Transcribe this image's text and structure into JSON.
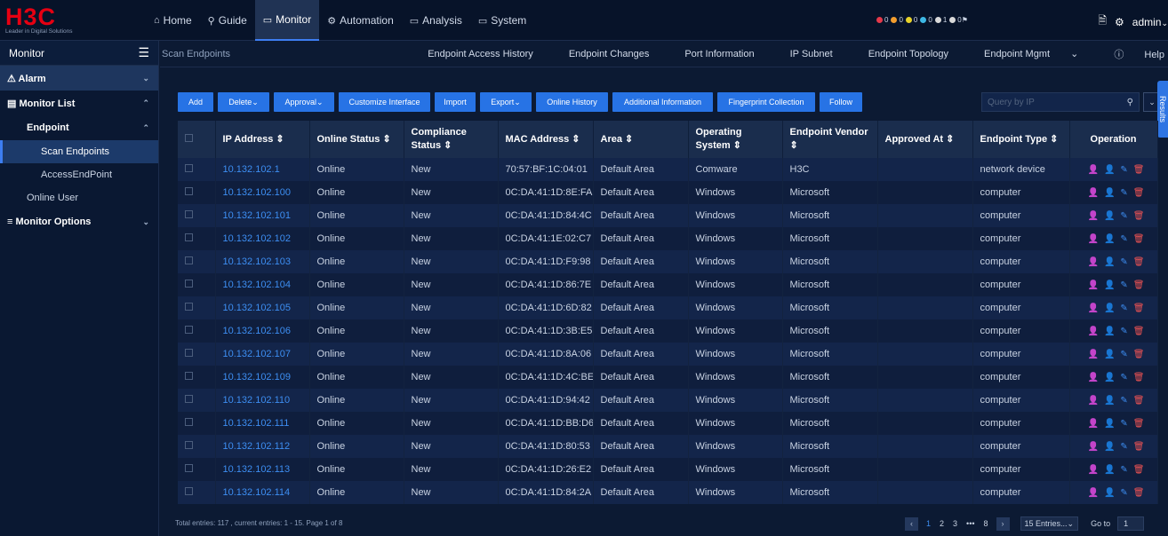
{
  "brand": {
    "name": "H3C",
    "tagline": "Leader in Digital Solutions"
  },
  "nav": [
    {
      "label": "Home",
      "icon": "home-icon",
      "glyph": "⌂",
      "active": false
    },
    {
      "label": "Guide",
      "icon": "guide-icon",
      "glyph": "⚲",
      "active": false
    },
    {
      "label": "Monitor",
      "icon": "monitor-icon",
      "glyph": "▭",
      "active": true
    },
    {
      "label": "Automation",
      "icon": "automation-icon",
      "glyph": "⚙",
      "active": false
    },
    {
      "label": "Analysis",
      "icon": "analysis-icon",
      "glyph": "▭",
      "active": false
    },
    {
      "label": "System",
      "icon": "system-icon",
      "glyph": "▭",
      "active": false
    }
  ],
  "status_counts": [
    {
      "color": "#e5394a",
      "count": "0"
    },
    {
      "color": "#f29d2e",
      "count": "0"
    },
    {
      "color": "#e8d32a",
      "count": "0"
    },
    {
      "color": "#3db8e5",
      "count": "0"
    },
    {
      "color": "#d9d9d9",
      "count": "1"
    },
    {
      "color": "#d9d9d9",
      "count": "0"
    }
  ],
  "user": {
    "name": "admin"
  },
  "sidebar": {
    "title": "Monitor",
    "alarm": "Alarm",
    "monitor_list": "Monitor List",
    "endpoint": "Endpoint",
    "scan_endpoints": "Scan Endpoints",
    "access_endpoint": "AccessEndPoint",
    "online_user": "Online User",
    "monitor_options": "Monitor Options"
  },
  "breadcrumb": "Scan Endpoints",
  "subtabs": [
    "Endpoint Access History",
    "Endpoint Changes",
    "Port Information",
    "IP Subnet",
    "Endpoint Topology",
    "Endpoint Mgmt"
  ],
  "help": "Help",
  "toolbar": [
    {
      "label": "Add",
      "dropdown": false,
      "w": 40
    },
    {
      "label": "Delete",
      "dropdown": true,
      "w": 58
    },
    {
      "label": "Approval",
      "dropdown": true,
      "w": 68
    },
    {
      "label": "Customize Interface",
      "dropdown": false,
      "w": 103
    },
    {
      "label": "Import",
      "dropdown": false,
      "w": 46
    },
    {
      "label": "Export",
      "dropdown": true,
      "w": 58
    },
    {
      "label": "Online History",
      "dropdown": false,
      "w": 81
    },
    {
      "label": "Additional Information",
      "dropdown": false,
      "w": 113
    },
    {
      "label": "Fingerprint Collection",
      "dropdown": false,
      "w": 110
    },
    {
      "label": "Follow",
      "dropdown": false,
      "w": 48
    }
  ],
  "search": {
    "placeholder": "Query by IP"
  },
  "results_tab": "Results",
  "table": {
    "columns": [
      "IP Address",
      "Online Status",
      "Compliance Status",
      "MAC Address",
      "Area",
      "Operating System",
      "Endpoint Vendor",
      "Approved At",
      "Endpoint Type",
      "Operation"
    ],
    "rows": [
      [
        "10.132.102.1",
        "Online",
        "New",
        "70:57:BF:1C:04:01",
        "Default Area",
        "Comware",
        "H3C",
        "",
        "network device"
      ],
      [
        "10.132.102.100",
        "Online",
        "New",
        "0C:DA:41:1D:8E:FA",
        "Default Area",
        "Windows",
        "Microsoft",
        "",
        "computer"
      ],
      [
        "10.132.102.101",
        "Online",
        "New",
        "0C:DA:41:1D:84:4C",
        "Default Area",
        "Windows",
        "Microsoft",
        "",
        "computer"
      ],
      [
        "10.132.102.102",
        "Online",
        "New",
        "0C:DA:41:1E:02:C7",
        "Default Area",
        "Windows",
        "Microsoft",
        "",
        "computer"
      ],
      [
        "10.132.102.103",
        "Online",
        "New",
        "0C:DA:41:1D:F9:98",
        "Default Area",
        "Windows",
        "Microsoft",
        "",
        "computer"
      ],
      [
        "10.132.102.104",
        "Online",
        "New",
        "0C:DA:41:1D:86:7E",
        "Default Area",
        "Windows",
        "Microsoft",
        "",
        "computer"
      ],
      [
        "10.132.102.105",
        "Online",
        "New",
        "0C:DA:41:1D:6D:82",
        "Default Area",
        "Windows",
        "Microsoft",
        "",
        "computer"
      ],
      [
        "10.132.102.106",
        "Online",
        "New",
        "0C:DA:41:1D:3B:E5",
        "Default Area",
        "Windows",
        "Microsoft",
        "",
        "computer"
      ],
      [
        "10.132.102.107",
        "Online",
        "New",
        "0C:DA:41:1D:8A:06",
        "Default Area",
        "Windows",
        "Microsoft",
        "",
        "computer"
      ],
      [
        "10.132.102.109",
        "Online",
        "New",
        "0C:DA:41:1D:4C:BE",
        "Default Area",
        "Windows",
        "Microsoft",
        "",
        "computer"
      ],
      [
        "10.132.102.110",
        "Online",
        "New",
        "0C:DA:41:1D:94:42",
        "Default Area",
        "Windows",
        "Microsoft",
        "",
        "computer"
      ],
      [
        "10.132.102.111",
        "Online",
        "New",
        "0C:DA:41:1D:BB:D6",
        "Default Area",
        "Windows",
        "Microsoft",
        "",
        "computer"
      ],
      [
        "10.132.102.112",
        "Online",
        "New",
        "0C:DA:41:1D:80:53",
        "Default Area",
        "Windows",
        "Microsoft",
        "",
        "computer"
      ],
      [
        "10.132.102.113",
        "Online",
        "New",
        "0C:DA:41:1D:26:E2",
        "Default Area",
        "Windows",
        "Microsoft",
        "",
        "computer"
      ],
      [
        "10.132.102.114",
        "Online",
        "New",
        "0C:DA:41:1D:84:2A",
        "Default Area",
        "Windows",
        "Microsoft",
        "",
        "computer"
      ]
    ]
  },
  "footer": "Total entries: 117 , current entries: 1 - 15. Page 1 of 8",
  "pager": {
    "pages": [
      "1",
      "2",
      "3",
      "•••",
      "8"
    ],
    "current": "1",
    "per_page": "15 Entries...",
    "goto_label": "Go to",
    "goto_value": "1"
  }
}
